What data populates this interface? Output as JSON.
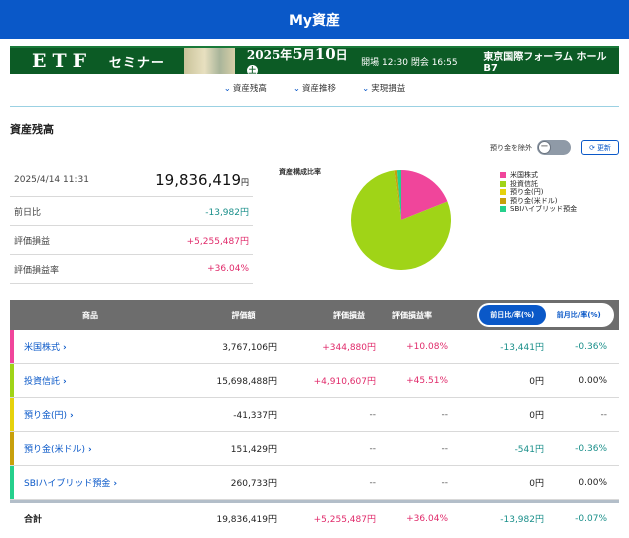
{
  "header": {
    "title": "My資産"
  },
  "banner": {
    "etf": "ETF",
    "seminar": "セミナー",
    "date_prefix": "2025年",
    "date_month": "5",
    "date_mid": "月",
    "date_day": "10",
    "date_suffix": "日",
    "weekday": "土",
    "time": "開場 12:30 閉会 16:55",
    "venue": "東京国際フォーラム ホールB7"
  },
  "anchors": [
    {
      "label": "資産残高"
    },
    {
      "label": "資産推移"
    },
    {
      "label": "実現損益"
    }
  ],
  "section": {
    "title": "資産残高",
    "exclude_deposit_label": "預り金を除外",
    "refresh_label": "更新"
  },
  "summary": {
    "datetime": "2025/4/14 11:31",
    "total_value": "19,836,419",
    "total_unit": "円",
    "rows": [
      {
        "label": "前日比",
        "value": "-13,982円"
      },
      {
        "label": "評価損益",
        "value": "+5,255,487円"
      },
      {
        "label": "評価損益率",
        "value": "+36.04%"
      }
    ]
  },
  "chart_data": {
    "type": "pie",
    "title": "資産構成比率",
    "labels": [
      "米国株式",
      "投資信託",
      "預り金(円)",
      "預り金(米ドル)",
      "SBIハイブリッド預金"
    ],
    "values": [
      3767106,
      15698488,
      0,
      151429,
      260733
    ],
    "colors": [
      "#f0459b",
      "#a0d417",
      "#e6d20c",
      "#c8a00c",
      "#25d08c"
    ],
    "legend_position": "right"
  },
  "table": {
    "headers": [
      "商品",
      "評価額",
      "評価損益",
      "評価損益率"
    ],
    "toggle": [
      "前日比/率(%)",
      "前月比/率(%)"
    ],
    "rows": [
      {
        "name": "米国株式",
        "chev": "›",
        "value": "3,767,106円",
        "pl": "+344,880円",
        "plr": "+10.08%",
        "diff": "-13,441円",
        "diffr": "-0.36%",
        "color": "#f0459b"
      },
      {
        "name": "投資信託",
        "chev": "›",
        "value": "15,698,488円",
        "pl": "+4,910,607円",
        "plr": "+45.51%",
        "diff": "0円",
        "diffr": "0.00%",
        "color": "#a0d417"
      },
      {
        "name": "預り金(円)",
        "chev": "›",
        "value": "-41,337円",
        "pl": "--",
        "plr": "--",
        "diff": "0円",
        "diffr": "--",
        "color": "#e6d20c"
      },
      {
        "name": "預り金(米ドル)",
        "chev": "›",
        "value": "151,429円",
        "pl": "--",
        "plr": "--",
        "diff": "-541円",
        "diffr": "-0.36%",
        "color": "#c8a00c"
      },
      {
        "name": "SBIハイブリッド預金",
        "chev": "›",
        "value": "260,733円",
        "pl": "--",
        "plr": "--",
        "diff": "0円",
        "diffr": "0.00%",
        "color": "#25d08c"
      }
    ],
    "total": {
      "name": "合計",
      "value": "19,836,419円",
      "pl": "+5,255,487円",
      "plr": "+36.04%",
      "diff": "-13,982円",
      "diffr": "-0.07%"
    }
  }
}
